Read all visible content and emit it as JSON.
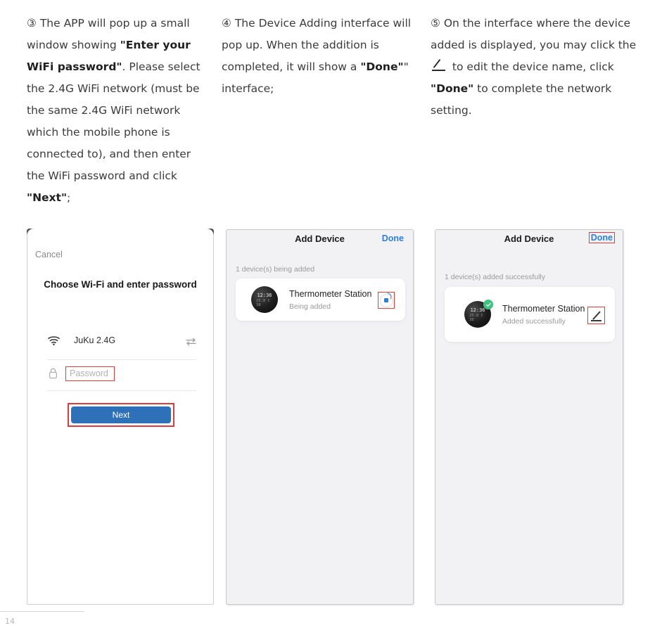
{
  "instructions": [
    {
      "marker": "③",
      "segments": [
        {
          "text": "③ The APP will pop up a small window showing ",
          "bold": false
        },
        {
          "text": "\"Enter your WiFi password\"",
          "bold": true
        },
        {
          "text": ". Please select the 2.4G WiFi network (must be the same 2.4G WiFi network which the mobile phone is connected to), and then enter the WiFi password and click ",
          "bold": false
        },
        {
          "text": "\"Next\"",
          "bold": true
        },
        {
          "text": ";",
          "bold": false
        }
      ]
    },
    {
      "marker": "④",
      "segments": [
        {
          "text": "④ The Device Adding interface will pop up. When the addition is completed, it will show a ",
          "bold": false
        },
        {
          "text": "\"Done\"",
          "bold": true
        },
        {
          "text": "\" interface;",
          "bold": false
        }
      ]
    },
    {
      "marker": "⑤",
      "segments": [
        {
          "text": "⑤ On the interface where the device added is displayed, you may click the ",
          "bold": false
        },
        {
          "text": "PENCIL_ICON",
          "bold": false
        },
        {
          "text": " to edit the device name, click ",
          "bold": false
        },
        {
          "text": "\"Done\"",
          "bold": true
        },
        {
          "text": " to complete the network setting.",
          "bold": false
        }
      ]
    }
  ],
  "instruction_text": {
    "step3_a": "③ The APP will pop up a small window showing ",
    "step3_b": "\"Enter your WiFi password\"",
    "step3_c": ". Please select the 2.4G WiFi network (must be the same 2.4G WiFi network which the mobile phone is connected to), and then enter the WiFi password and click ",
    "step3_d": "\"Next\"",
    "step3_e": ";",
    "step4_a": "④ The Device Adding interface will pop up. When the addition is completed, it will show a ",
    "step4_b": "\"Done\"",
    "step4_c": "\" interface;",
    "step5_a": "⑤ On the interface where the device added is displayed, you may click the ",
    "step5_b": " to edit the device name, click ",
    "step5_c": "\"Done\"",
    "step5_d": " to complete the network setting."
  },
  "phone1": {
    "cancel_label": "Cancel",
    "title": "Choose Wi-Fi and enter password",
    "wifi_name": "JuKu 2.4G",
    "password_placeholder": "Password",
    "next_label": "Next",
    "icons": {
      "wifi": "wifi-icon",
      "swap": "swap-network-icon",
      "lock": "lock-icon"
    },
    "accent_color": "#2e71b8",
    "highlight_color": "#e03a3a"
  },
  "phone2": {
    "title": "Add Device",
    "done_label": "Done",
    "count_label": "1 device(s) being added",
    "device": {
      "name": "Thermometer Station",
      "status": "Being added",
      "watch_time": "12:36",
      "watch_sub": "25.8 C 38",
      "action_icon": "loading-spinner-icon"
    },
    "done_color": "#2a7fe0",
    "highlight_color": "#e03a3a"
  },
  "phone3": {
    "title": "Add Device",
    "done_label": "Done",
    "count_label": "1 device(s) added successfully",
    "device": {
      "name": "Thermometer Station",
      "status": "Added successfully",
      "watch_time": "12:36",
      "watch_sub": "25.8 C 38",
      "badge_icon": "check-circle-icon",
      "action_icon": "pencil-edit-icon"
    },
    "done_color": "#2a7fe0",
    "badge_color": "#3fc47f",
    "highlight_color": "#e03a3a"
  },
  "footer": {
    "page_number": "14"
  }
}
